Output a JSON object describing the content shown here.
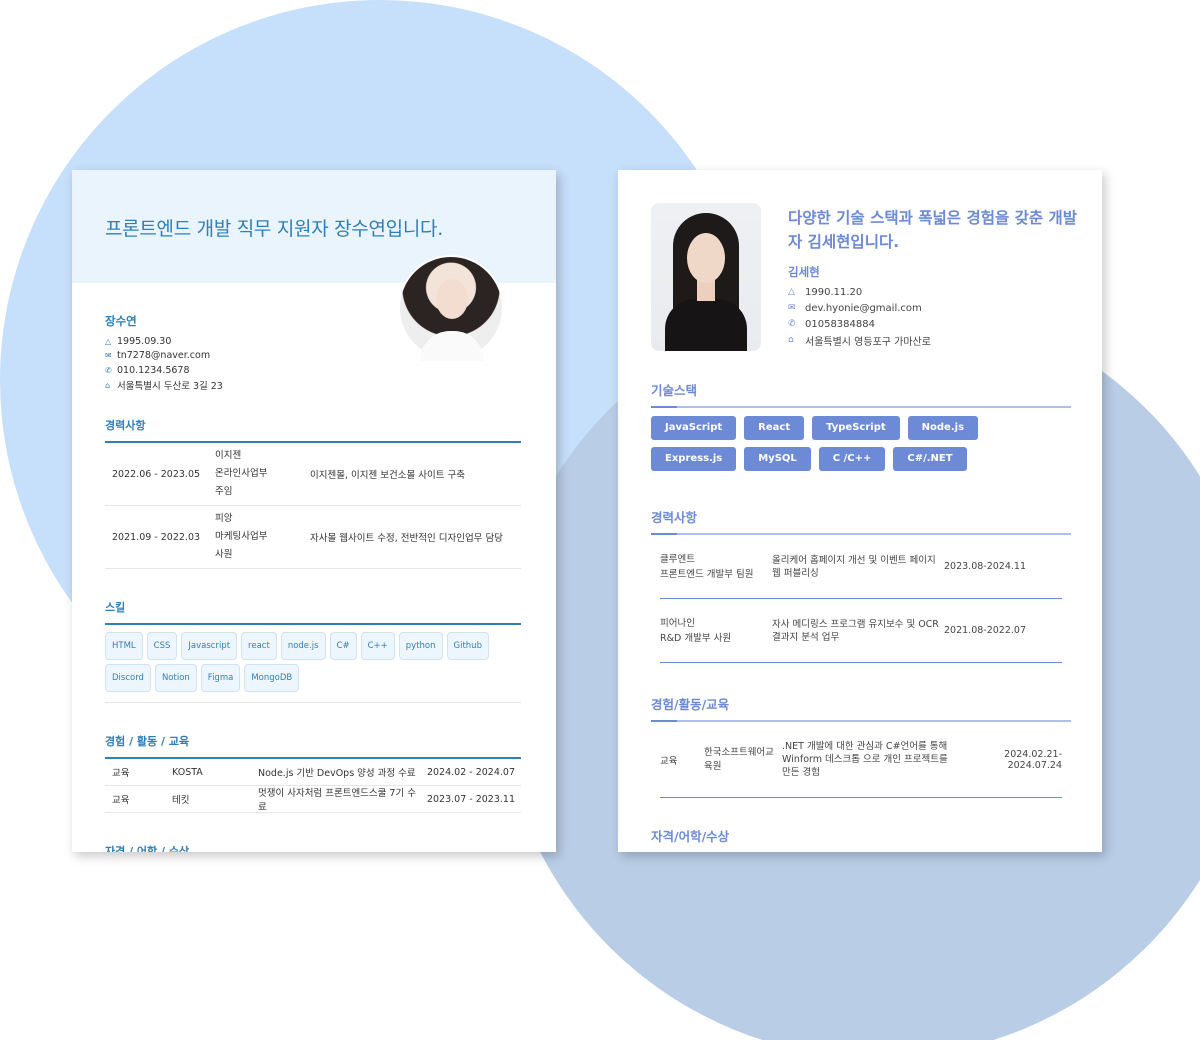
{
  "resume1": {
    "headline": "프론트엔드 개발 직무 지원자 장수연입니다.",
    "name": "장수연",
    "birth": "1995.09.30",
    "email": "tn7278@naver.com",
    "phone": "010.1234.5678",
    "address": "서울특별시 두산로 3길 23",
    "career_title": "경력사항",
    "career": [
      {
        "period": "2022.06 - 2023.05",
        "org": [
          "이지젠",
          "온라인사업부",
          "주임"
        ],
        "desc": "이지젠몰, 이지젠 보건소몰 사이트 구축"
      },
      {
        "period": "2021.09 - 2022.03",
        "org": [
          "피앙",
          "마케팅사업부",
          "사원"
        ],
        "desc": "자사몰 웹사이트 수정, 전반적인 디자인업무 담당"
      }
    ],
    "skills_title": "스킬",
    "skills": [
      "HTML",
      "CSS",
      "Javascript",
      "react",
      "node.js",
      "C#",
      "C++",
      "python",
      "Github",
      "Discord",
      "Notion",
      "Figma",
      "MongoDB"
    ],
    "edu_title": "경험 / 활동 / 교육",
    "edu": [
      {
        "type": "교육",
        "org": "KOSTA",
        "desc": "Node.js 기반 DevOps 양성 과정 수료",
        "period": "2024.02 - 2024.07"
      },
      {
        "type": "교육",
        "org": "테킷",
        "desc": "멋쟁이 사자처럼 프론트엔드스쿨 7기 수료",
        "period": "2023.07 - 2023.11"
      }
    ],
    "next_title": "자격 / 어학 / 수상"
  },
  "resume2": {
    "headline": "다양한 기술 스택과 폭넓은 경험을 갖춘 개발자 김세현입니다.",
    "name": "김세현",
    "birth": "1990.11.20",
    "email": "dev.hyonie@gmail.com",
    "phone": "01058384884",
    "address": "서울특별시 영등포구 가마산로",
    "stack_title": "기술스택",
    "stack": [
      "JavaScript",
      "React",
      "TypeScript",
      "Node.js",
      "Express.js",
      "MySQL",
      "C /C++",
      "C#/.NET"
    ],
    "career_title": "경력사항",
    "career": [
      {
        "org": [
          "클루엔트",
          "프론트엔드 개발부 팀원"
        ],
        "desc": "올리케어 홈페이지 개선 및 이벤트 페이지 웹 퍼블리싱",
        "period": "2023.08-2024.11"
      },
      {
        "org": [
          "피어나인",
          "R&D 개발부 사원"
        ],
        "desc": "자사 메디링스 프로그램 유지보수 및 OCR 결과지 분석 업무",
        "period": "2021.08-2022.07"
      }
    ],
    "exp_title": "경험/활동/교육",
    "exp": [
      {
        "type": "교육",
        "org": "한국소프트웨어교육원",
        "desc": ".NET 개발에 대한 관심과 C#언어를 통해 Winform 데스크톱 으로 개인 프로젝트를 만든 경험",
        "period": "2024.02.21-2024.07.24"
      }
    ],
    "next_title": "자격/어학/수상"
  },
  "colors": {
    "r1_accent": "#2e7fb8",
    "r2_accent": "#6d8ad6",
    "blob_light": "#c6dffa",
    "blob_dark": "#b9cde6"
  },
  "icons": {
    "birth": "cake-icon",
    "email": "mail-icon",
    "phone": "phone-icon",
    "address": "home-icon"
  }
}
